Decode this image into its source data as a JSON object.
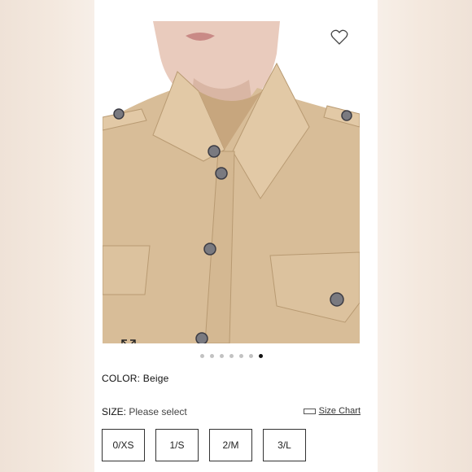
{
  "product": {
    "color_label": "COLOR:",
    "color_value": "Beige",
    "size_label": "SIZE:",
    "size_prompt": "Please select",
    "size_chart_link": "Size Chart",
    "sizes": [
      "0/XS",
      "1/S",
      "2/M",
      "3/L"
    ]
  },
  "gallery": {
    "image_count": 7,
    "active_index": 6
  },
  "icons": {
    "wishlist": "heart-icon",
    "zoom": "expand-icon",
    "size_chart": "ruler-icon"
  },
  "colors": {
    "garment": "#d8bd98",
    "active_dot": "#111111",
    "inactive_dot": "#c2c2c2"
  }
}
